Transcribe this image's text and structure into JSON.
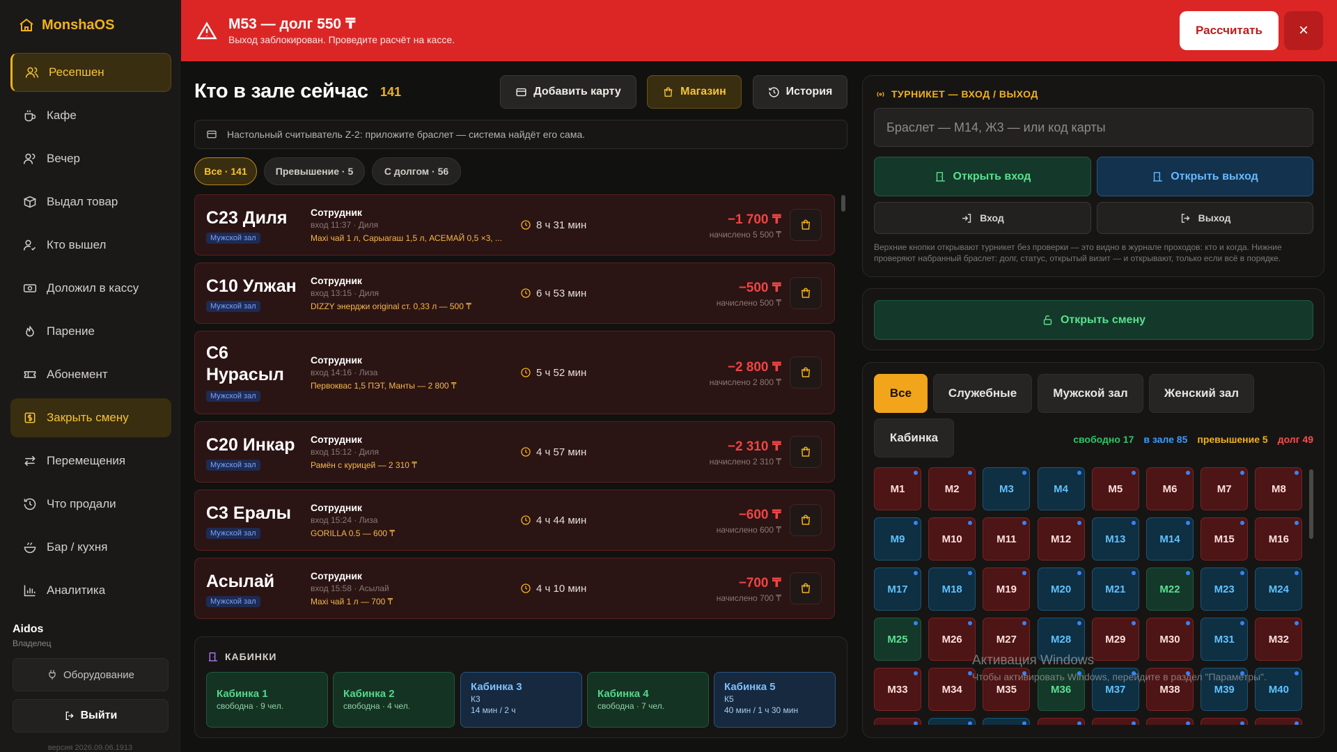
{
  "app": {
    "name": "MonshaOS",
    "version": "версия 2026.09.06.1913"
  },
  "sidebar": {
    "items": [
      {
        "label": "Ресепшен",
        "icon": "users-icon",
        "state": "active"
      },
      {
        "label": "Кафе",
        "icon": "coffee-icon"
      },
      {
        "label": "Вечер",
        "icon": "users-icon"
      },
      {
        "label": "Выдал товар",
        "icon": "box-icon"
      },
      {
        "label": "Кто вышел",
        "icon": "user-check-icon"
      },
      {
        "label": "Доложил в кассу",
        "icon": "cash-icon"
      },
      {
        "label": "Парение",
        "icon": "flame-icon"
      },
      {
        "label": "Абонемент",
        "icon": "ticket-icon"
      },
      {
        "label": "Закрыть смену",
        "icon": "dollar-icon",
        "state": "highlight"
      },
      {
        "label": "Перемещения",
        "icon": "transfer-icon"
      },
      {
        "label": "Что продали",
        "icon": "history-icon"
      },
      {
        "label": "Бар / кухня",
        "icon": "bowl-icon"
      },
      {
        "label": "Аналитика",
        "icon": "chart-icon"
      }
    ],
    "user": {
      "name": "Aidos",
      "role": "Владелец"
    },
    "equipment_label": "Оборудование",
    "logout_label": "Выйти"
  },
  "alert": {
    "title": "М53 — долг 550 ₸",
    "subtitle": "Выход заблокирован. Проведите расчёт на кассе.",
    "pay_label": "Рассчитать",
    "close_label": "×",
    "color": "#dc2626"
  },
  "main": {
    "title": "Кто в зале сейчас",
    "count": "141",
    "buttons": {
      "add_card": "Добавить карту",
      "shop": "Магазин",
      "history": "История"
    },
    "reader_text": "Настольный считыватель Z-2: приложите браслет — система найдёт его сама.",
    "filters": [
      "Все · 141",
      "Превышение · 5",
      "С долгом · 56"
    ],
    "active_filter": "Все · 141",
    "guests": [
      {
        "name": "С23 Диля",
        "zone": "Мужской зал",
        "role": "Сотрудник",
        "entry": "вход 11:37 · Диля",
        "items": "Maxi чай 1 л, Сарыагаш 1,5 л, АСЕМАЙ 0,5 ×3, ...",
        "duration": "8 ч 31 мин",
        "amount": "−1 700 ₸",
        "accrued": "начислено 5 500 ₸"
      },
      {
        "name": "С10 Улжан",
        "zone": "Мужской зал",
        "role": "Сотрудник",
        "entry": "вход 13:15 · Диля",
        "items": "DIZZY энерджи original ст. 0,33 л — 500 ₸",
        "duration": "6 ч 53 мин",
        "amount": "−500 ₸",
        "accrued": "начислено 500 ₸"
      },
      {
        "name_line1": "С6",
        "name_line2": "Нурасыл",
        "zone": "Мужской зал",
        "role": "Сотрудник",
        "entry": "вход 14:16 · Лиза",
        "items": "Первоквас 1,5 ПЭТ, Манты — 2 800 ₸",
        "duration": "5 ч 52 мин",
        "amount": "−2 800 ₸",
        "accrued": "начислено 2 800 ₸"
      },
      {
        "name": "С20 Инкар",
        "zone": "Мужской зал",
        "role": "Сотрудник",
        "entry": "вход 15:12 · Диля",
        "items": "Рамён с курицей — 2 310 ₸",
        "duration": "4 ч 57 мин",
        "amount": "−2 310 ₸",
        "accrued": "начислено 2 310 ₸"
      },
      {
        "name": "С3 Ералы",
        "zone": "Мужской зал",
        "role": "Сотрудник",
        "entry": "вход 15:24 · Лиза",
        "items": "GORILLA 0.5 — 600 ₸",
        "duration": "4 ч 44 мин",
        "amount": "−600 ₸",
        "accrued": "начислено 600 ₸"
      },
      {
        "name": "Асылай",
        "zone": "Мужской зал",
        "role": "Сотрудник",
        "entry": "вход 15:58 · Асылай",
        "items": "Maxi чай 1 л — 700 ₸",
        "duration": "4 ч 10 мин",
        "amount": "−700 ₸",
        "accrued": "начислено 700 ₸"
      }
    ],
    "cabins_title": "КАБИНКИ",
    "cabins": [
      {
        "name": "Кабинка 1",
        "status": "свободна · 9 чел.",
        "state": "free"
      },
      {
        "name": "Кабинка 2",
        "status": "свободна · 4 чел.",
        "state": "free"
      },
      {
        "name": "Кабинка 3",
        "code": "К3",
        "time": "14 мин / 2 ч",
        "state": "busy"
      },
      {
        "name": "Кабинка 4",
        "status": "свободна · 7 чел.",
        "state": "free"
      },
      {
        "name": "Кабинка 5",
        "code": "К5",
        "time": "40 мин / 1 ч 30 мин",
        "state": "busy"
      }
    ]
  },
  "turnstile": {
    "title": "ТУРНИКЕТ — ВХОД / ВЫХОД",
    "input_placeholder": "Браслет — М14, Ж3 — или код карты",
    "open_entry": "Открыть вход",
    "open_exit": "Открыть выход",
    "entry": "Вход",
    "exit": "Выход",
    "note": "Верхние кнопки открывают турникет без проверки — это видно в журнале проходов: кто и когда. Нижние проверяют набранный браслет: долг, статус, открытый визит — и открывают, только если всё в порядке."
  },
  "shift": {
    "open_label": "Открыть смену"
  },
  "lockers": {
    "filters": [
      "Все",
      "Служебные",
      "Мужской зал",
      "Женский зал",
      "Кабинка"
    ],
    "active_filter": "Все",
    "stats": {
      "free": "свободно 17",
      "in_hall": "в зале 85",
      "over": "превышение 5",
      "debt": "долг 49"
    },
    "stat_colors": {
      "free": "#2fc56a",
      "in_hall": "#3b9cff",
      "over": "#f2b21b",
      "debt": "#ff4d4d"
    },
    "cells": [
      {
        "label": "М1",
        "s": "r"
      },
      {
        "label": "М2",
        "s": "r"
      },
      {
        "label": "М3",
        "s": "bl"
      },
      {
        "label": "М4",
        "s": "bl"
      },
      {
        "label": "М5",
        "s": "r"
      },
      {
        "label": "М6",
        "s": "r"
      },
      {
        "label": "М7",
        "s": "r"
      },
      {
        "label": "М8",
        "s": "r"
      },
      {
        "label": "М9",
        "s": "bl"
      },
      {
        "label": "М10",
        "s": "r"
      },
      {
        "label": "М11",
        "s": "r"
      },
      {
        "label": "М12",
        "s": "r"
      },
      {
        "label": "М13",
        "s": "bl"
      },
      {
        "label": "М14",
        "s": "bl"
      },
      {
        "label": "М15",
        "s": "r"
      },
      {
        "label": "М16",
        "s": "r"
      },
      {
        "label": "М17",
        "s": "bl"
      },
      {
        "label": "М18",
        "s": "bl"
      },
      {
        "label": "М19",
        "s": "r"
      },
      {
        "label": "М20",
        "s": "bl"
      },
      {
        "label": "М21",
        "s": "bl"
      },
      {
        "label": "М22",
        "s": "gr"
      },
      {
        "label": "М23",
        "s": "bl"
      },
      {
        "label": "М24",
        "s": "bl"
      },
      {
        "label": "М25",
        "s": "gr"
      },
      {
        "label": "М26",
        "s": "r"
      },
      {
        "label": "М27",
        "s": "r"
      },
      {
        "label": "М28",
        "s": "bl"
      },
      {
        "label": "М29",
        "s": "r"
      },
      {
        "label": "М30",
        "s": "r"
      },
      {
        "label": "М31",
        "s": "bl"
      },
      {
        "label": "М32",
        "s": "r"
      },
      {
        "label": "М33",
        "s": "r"
      },
      {
        "label": "М34",
        "s": "r"
      },
      {
        "label": "М35",
        "s": "r"
      },
      {
        "label": "М36",
        "s": "gr"
      },
      {
        "label": "М37",
        "s": "bl"
      },
      {
        "label": "М38",
        "s": "r"
      },
      {
        "label": "М39",
        "s": "bl"
      },
      {
        "label": "М40",
        "s": "bl"
      },
      {
        "label": "",
        "s": "r"
      },
      {
        "label": "",
        "s": "bl"
      },
      {
        "label": "",
        "s": "bl"
      },
      {
        "label": "",
        "s": "r"
      },
      {
        "label": "",
        "s": "r"
      },
      {
        "label": "",
        "s": "r"
      },
      {
        "label": "",
        "s": "r"
      },
      {
        "label": "",
        "s": "r"
      }
    ]
  },
  "watermark": {
    "line1": "Активация Windows",
    "line2": "Чтобы активировать Windows, перейдите в раздел \"Параметры\"."
  }
}
